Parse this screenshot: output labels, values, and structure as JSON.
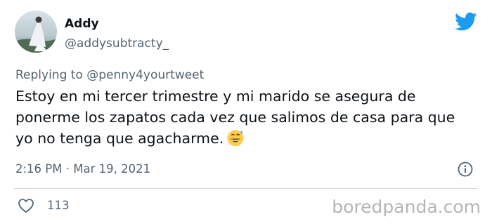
{
  "author": {
    "display_name": "Addy",
    "handle": "@addysubtracty_"
  },
  "reply": {
    "prefix": "Replying to ",
    "handle": "@penny4yourtweet"
  },
  "tweet": {
    "text": "Estoy en mi tercer trimestre y mi marido se asegura de ponerme los zapatos cada vez que salimos de casa para que yo no tenga que agacharme.",
    "emoji_icon": "grinning-face-with-sweat-icon"
  },
  "meta": {
    "timestamp": "2:16 PM · Mar 19, 2021"
  },
  "actions": {
    "like_count": "113"
  },
  "watermark": "boredpanda.com",
  "colors": {
    "twitter_blue": "#1d9bf0",
    "secondary_text": "#536471",
    "primary_text": "#0f1419",
    "divider": "#cfd9de"
  }
}
